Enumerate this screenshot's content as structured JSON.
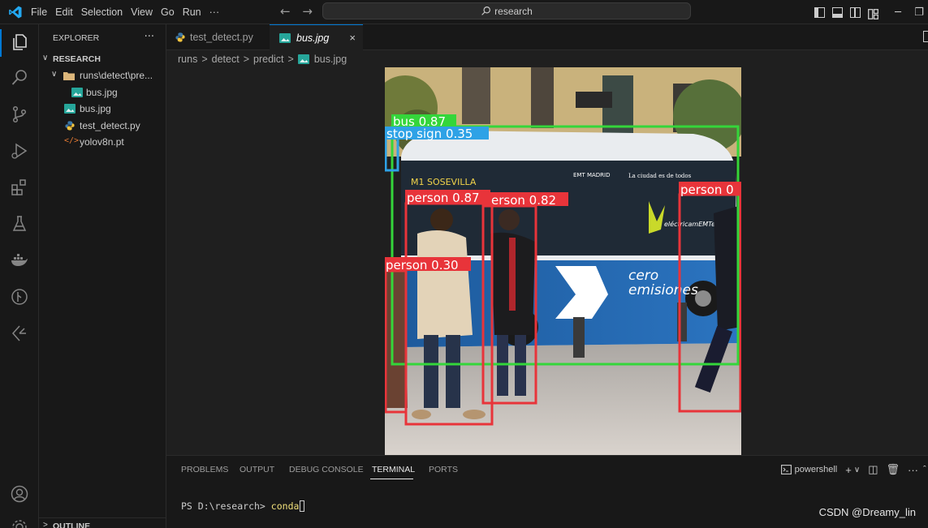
{
  "menu": {
    "items": [
      "File",
      "Edit",
      "Selection",
      "View",
      "Go",
      "Run",
      "···"
    ]
  },
  "search": {
    "text": "research"
  },
  "nav": {
    "back": "←",
    "forward": "→"
  },
  "explorer": {
    "title": "EXPLORER",
    "more": "···",
    "root": "RESEARCH",
    "items": [
      {
        "label": "runs\\detect\\pre...",
        "type": "folder"
      },
      {
        "label": "bus.jpg",
        "type": "image"
      },
      {
        "label": "bus.jpg",
        "type": "image"
      },
      {
        "label": "test_detect.py",
        "type": "python"
      },
      {
        "label": "yolov8n.pt",
        "type": "model"
      }
    ],
    "outline": "OUTLINE"
  },
  "tabs": [
    {
      "label": "test_detect.py",
      "icon": "python-icon"
    },
    {
      "label": "bus.jpg",
      "icon": "image-icon",
      "close": "×"
    }
  ],
  "breadcrumb": [
    "runs",
    "detect",
    "predict",
    "bus.jpg"
  ],
  "detections": [
    {
      "label": "bus 0.87",
      "color": "#34d63a"
    },
    {
      "label": "stop sign 0.35",
      "color": "#2ea2e6"
    },
    {
      "label": "person 0.87",
      "color": "#e8343a"
    },
    {
      "label": "erson 0.82",
      "color": "#e8343a"
    },
    {
      "label": "person 0",
      "color": "#e8343a"
    },
    {
      "label": "person 0.30",
      "color": "#e8343a"
    }
  ],
  "bus_sign": {
    "route": "M1 SOSEVILLA",
    "emt": "EMT MADRID",
    "banner": "La ciudad es de todos",
    "brand": "eléctricamEMTe",
    "slogan_1": "cero",
    "slogan_2": "emisiones"
  },
  "panel": {
    "tabs": [
      "PROBLEMS",
      "OUTPUT",
      "DEBUG CONSOLE",
      "TERMINAL",
      "PORTS"
    ],
    "active_tab": "TERMINAL",
    "shell": "powershell",
    "prompt": "PS D:\\research>",
    "command": "conda"
  },
  "watermark": "CSDN @Dreamy_lin",
  "colors": {
    "accent": "#0078d4",
    "background": "#1f1f1f",
    "sidebar": "#181818"
  }
}
